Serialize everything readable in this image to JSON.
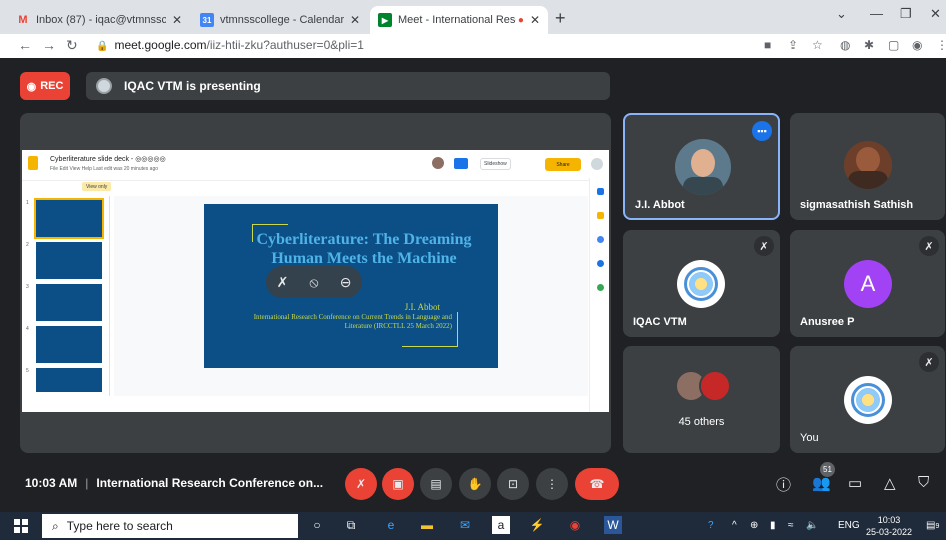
{
  "browser": {
    "tabs": [
      {
        "title": "Inbox (87) - iqac@vtmnsscollege",
        "icon": "gmail-icon"
      },
      {
        "title": "vtmnsscollege - Calendar - Frida",
        "icon": "calendar-icon"
      },
      {
        "title": "Meet - International Researc",
        "icon": "meet-icon"
      }
    ],
    "new_tab": "+",
    "url_host": "meet.google.com",
    "url_path": "/iiz-htii-zku?authuser=0&pli=1"
  },
  "meet": {
    "rec_label": "REC",
    "presenting_label": "IQAC VTM is presenting",
    "slides_app": {
      "doc_title": "Cyberliterature slide deck - ◎◎◎◎◎",
      "menu": "File  Edit  View  Help   Last edit was 20 minutes ago",
      "slideshow_label": "Slideshow",
      "share_label": "Share",
      "view_only_label": "View only",
      "thumb_numbers": [
        "1",
        "2",
        "3",
        "4",
        "5"
      ]
    },
    "slide": {
      "title": "Cyberliterature: The Dreaming Human Meets the Machine",
      "author": "J.I. Abbot",
      "subtitle": "International Research Conference on Current Trends in Language and Literature (IRCCTLL 25 March 2022)"
    },
    "participants": [
      {
        "name": "J.I. Abbot",
        "avatar": "photo"
      },
      {
        "name": "sigmasathish Sathish",
        "avatar": "photo"
      },
      {
        "name": "IQAC VTM",
        "avatar": "seal"
      },
      {
        "name": "Anusree P",
        "avatar": "letter",
        "letter": "A"
      },
      {
        "name": "45 others",
        "avatar": "group"
      },
      {
        "name": "You",
        "avatar": "seal"
      }
    ],
    "meeting_time": "10:03 AM",
    "meeting_title": "International Research Conference on...",
    "people_count": "51"
  },
  "taskbar": {
    "search_placeholder": "Type here to search",
    "lang": "ENG",
    "time": "10:03",
    "date": "25-03-2022",
    "notif_count": "9"
  },
  "colors": {
    "meet_bg": "#202124",
    "tile_bg": "#3c4043",
    "red": "#ea4335",
    "slide_blue": "#0b4f86",
    "slide_title": "#4fb3e8",
    "slide_accent": "#c9d94a",
    "active_border": "#8ab4f8"
  }
}
